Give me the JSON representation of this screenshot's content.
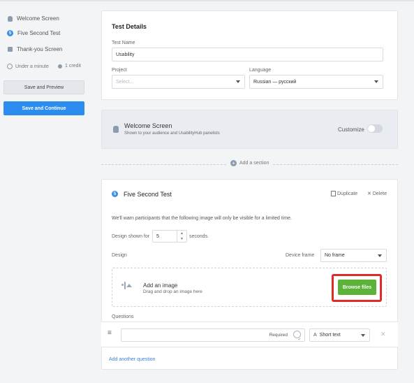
{
  "sidebar": {
    "items": [
      {
        "label": "Welcome Screen",
        "icon": "wave-hand-icon"
      },
      {
        "label": "Five Second Test",
        "icon": "five-badge-icon",
        "badge": "5"
      },
      {
        "label": "Thank-you Screen",
        "icon": "thumbs-up-icon"
      }
    ],
    "duration": "Under a minute",
    "credits": "1 credit",
    "save_preview": "Save and Preview",
    "save_continue": "Save and Continue"
  },
  "test_details": {
    "title": "Test Details",
    "test_name_label": "Test Name",
    "test_name_value": "Usability",
    "project_label": "Project",
    "project_placeholder": "Select...",
    "language_label": "Language",
    "language_value": "Russian — русский"
  },
  "welcome": {
    "title": "Welcome Screen",
    "subtitle": "Shown to your audience and UsabilityHub panelists",
    "customize": "Customize"
  },
  "add_section": "Add a section",
  "five_second": {
    "badge": "5",
    "title": "Five Second Test",
    "duplicate": "Duplicate",
    "delete": "Delete",
    "description": "We'll warn participants that the following image will only be visible for a limited time.",
    "design_shown_for": "Design shown for",
    "seconds_value": "5",
    "seconds_label": "seconds.",
    "design_label": "Design",
    "device_frame_label": "Device frame",
    "device_frame_value": "No frame",
    "add_image_title": "Add an image",
    "add_image_sub": "Drag and drop an image here",
    "browse_files": "Browse files",
    "questions_label": "Questions",
    "required_label": "Required",
    "answer_type": "Short text",
    "add_question": "Add another question"
  },
  "colors": {
    "accent_blue": "#2d8cf0",
    "green": "#5db23a",
    "highlight_red": "#e02b2b"
  }
}
